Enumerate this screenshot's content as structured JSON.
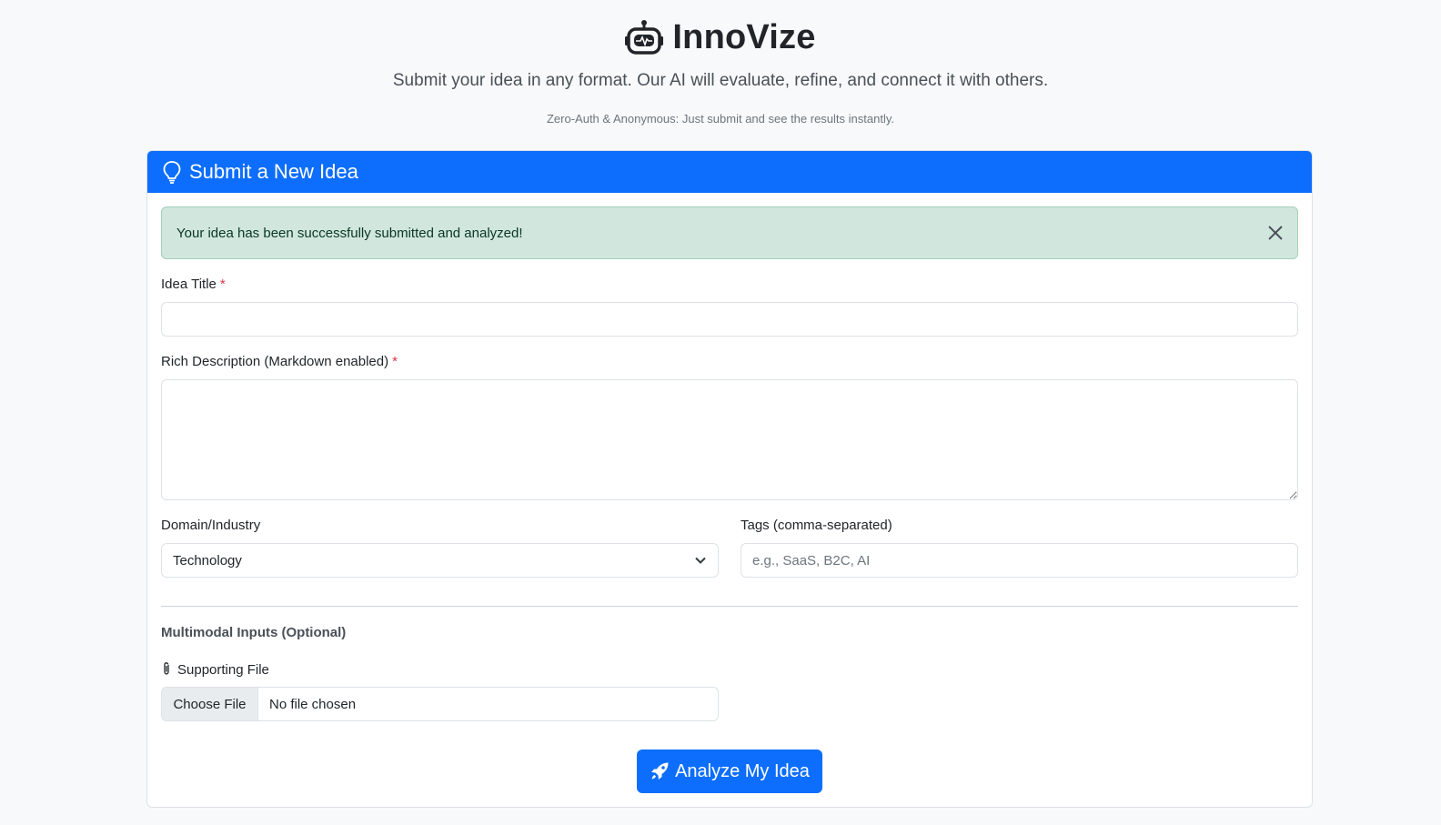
{
  "header": {
    "app_title": "InnoVize",
    "logo_icon": "robot-icon",
    "subtitle": "Submit your idea in any format. Our AI will evaluate, refine, and connect it with others.",
    "note": "Zero-Auth & Anonymous: Just submit and see the results instantly."
  },
  "card": {
    "title": "Submit a New Idea",
    "title_icon": "lightbulb-icon",
    "header_color": "#0d6efd"
  },
  "alert": {
    "message": "Your idea has been successfully submitted and analyzed!",
    "type": "success"
  },
  "form": {
    "title_label": "Idea Title",
    "title_value": "",
    "required_marker": "*",
    "description_label": "Rich Description (Markdown enabled)",
    "description_value": "",
    "domain_label": "Domain/Industry",
    "domain_selected": "Technology",
    "tags_label": "Tags (comma-separated)",
    "tags_placeholder": "e.g., SaaS, B2C, AI",
    "tags_value": ""
  },
  "multimodal": {
    "section_title": "Multimodal Inputs (Optional)",
    "file_label": "Supporting File",
    "file_icon": "paperclip-icon",
    "choose_file_label": "Choose File",
    "file_status": "No file chosen"
  },
  "submit": {
    "label": "Analyze My Idea",
    "icon": "rocket-icon"
  },
  "colors": {
    "primary": "#0d6efd",
    "success_bg": "#d1e7dd",
    "required": "#dc3545"
  }
}
